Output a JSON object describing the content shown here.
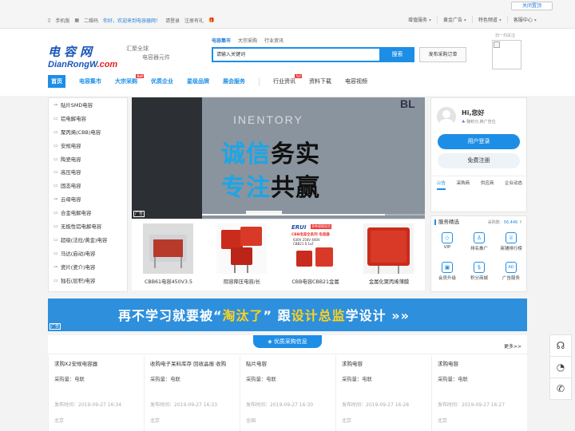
{
  "topbar": {
    "close_top": "关闭置顶",
    "mobile": "手机版",
    "qrcode": "二维码",
    "welcome": "你好，欢迎来到电容器网！",
    "login": "请登录",
    "register": "注册有礼",
    "right": [
      "增值服务",
      "黄金广告",
      "特色频道",
      "客服中心"
    ]
  },
  "logo": {
    "cn": "电容网",
    "en_main": "DianRongW",
    "en_dot": ".com",
    "slogan_1": "汇聚全球",
    "slogan_2": "电容器元件"
  },
  "search": {
    "tabs": [
      "电容集市",
      "大宗采购",
      "行业资讯"
    ],
    "placeholder": "请输入关键词",
    "button": "搜索",
    "publish": "发布采购订单",
    "qr_label": "扫一扫关注"
  },
  "nav": {
    "home": "首页",
    "primary": [
      "电容集市",
      "大宗采购",
      "优质企业",
      "星级品牌",
      "展会服务"
    ],
    "secondary": [
      "行业资讯",
      "资料下载",
      "电容视频"
    ],
    "hot": "hot"
  },
  "categories": [
    "贴片SMD电容",
    "铝电解电容",
    "聚丙烯(CBB)电容",
    "安规电容",
    "陶瓷电容",
    "高压电容",
    "固态电容",
    "云母电容",
    "合金电解电容",
    "无极性铝电解电容",
    "超级(法拉/黄金)电容",
    "马达(启动)电容",
    "瓷片(瓷介)电容",
    "独石(层积)电容"
  ],
  "banner": {
    "bg_text": "INENTORY",
    "corner": "BL",
    "line1_a": "诚信",
    "line1_b": "务实",
    "line2_a": "专注",
    "line2_b": "共赢",
    "ad": "广告",
    "progress": 0.82
  },
  "products": [
    {
      "caption": "CBB61电容450V3.5"
    },
    {
      "caption": "阻容降压电容/长"
    },
    {
      "caption": "CBB电容CBB21金属"
    },
    {
      "caption": "金属化聚丙烯薄膜"
    }
  ],
  "product_label": {
    "brand": "ERUI",
    "tag": "多种规格现货",
    "l1": "CBB电容全系列 电容器",
    "l2": "630V 250V 400V",
    "l3": "CBB21 0.1uF"
  },
  "user": {
    "greeting": "Hi,您好",
    "points": "赚积分,换广告位",
    "login": "用户登录",
    "register": "免费注册",
    "tabs": [
      "公告",
      "采购商",
      "供应商",
      "企业动态"
    ]
  },
  "services": {
    "title": "服务精选",
    "count_label": "采购数：",
    "count": "56,446",
    "items": [
      {
        "label": "VIP",
        "icon": "◇"
      },
      {
        "label": "排名推广",
        "icon": "♙"
      },
      {
        "label": "商铺排行榜",
        "icon": "♕"
      },
      {
        "label": "会员升级",
        "icon": "▣"
      },
      {
        "label": "积分商城",
        "icon": "$"
      },
      {
        "label": "广告服务",
        "icon": "AD"
      }
    ]
  },
  "wide_ad": {
    "t1": "再不学习就要被“",
    "t2": "淘汰了",
    "t3": "” 跟",
    "t4": "设计总监",
    "t5": "学设计 »»",
    "ad": "广告"
  },
  "info": {
    "heading": "优质采购信息",
    "more": "更多>>",
    "items": [
      {
        "title": "求购X2安规电容器",
        "qty": "采购量：电联",
        "date": "发布时间：2019-09-27 16:34",
        "loc": "北京"
      },
      {
        "title": "收购电子呆料库存 回收晶振 收购",
        "qty": "采购量：电联",
        "date": "发布时间：2019-09-27 16:33",
        "loc": "北京"
      },
      {
        "title": "贴片电容",
        "qty": "采购量：电联",
        "date": "发布时间：2019-09-27 16:30",
        "loc": "全国"
      },
      {
        "title": "求购电容",
        "qty": "采购量：电联",
        "date": "发布时间：2019-09-27 16:28",
        "loc": "北京"
      },
      {
        "title": "求购电容",
        "qty": "采购量：电联",
        "date": "发布时间：2019-09-27 16:27",
        "loc": "北京"
      }
    ]
  },
  "colors": {
    "accent": "#1d8ee6",
    "highlight": "#1aa6e8",
    "hot": "#e33333"
  },
  "float_icons": [
    "headset-icon",
    "wechat-icon",
    "phone-icon"
  ]
}
